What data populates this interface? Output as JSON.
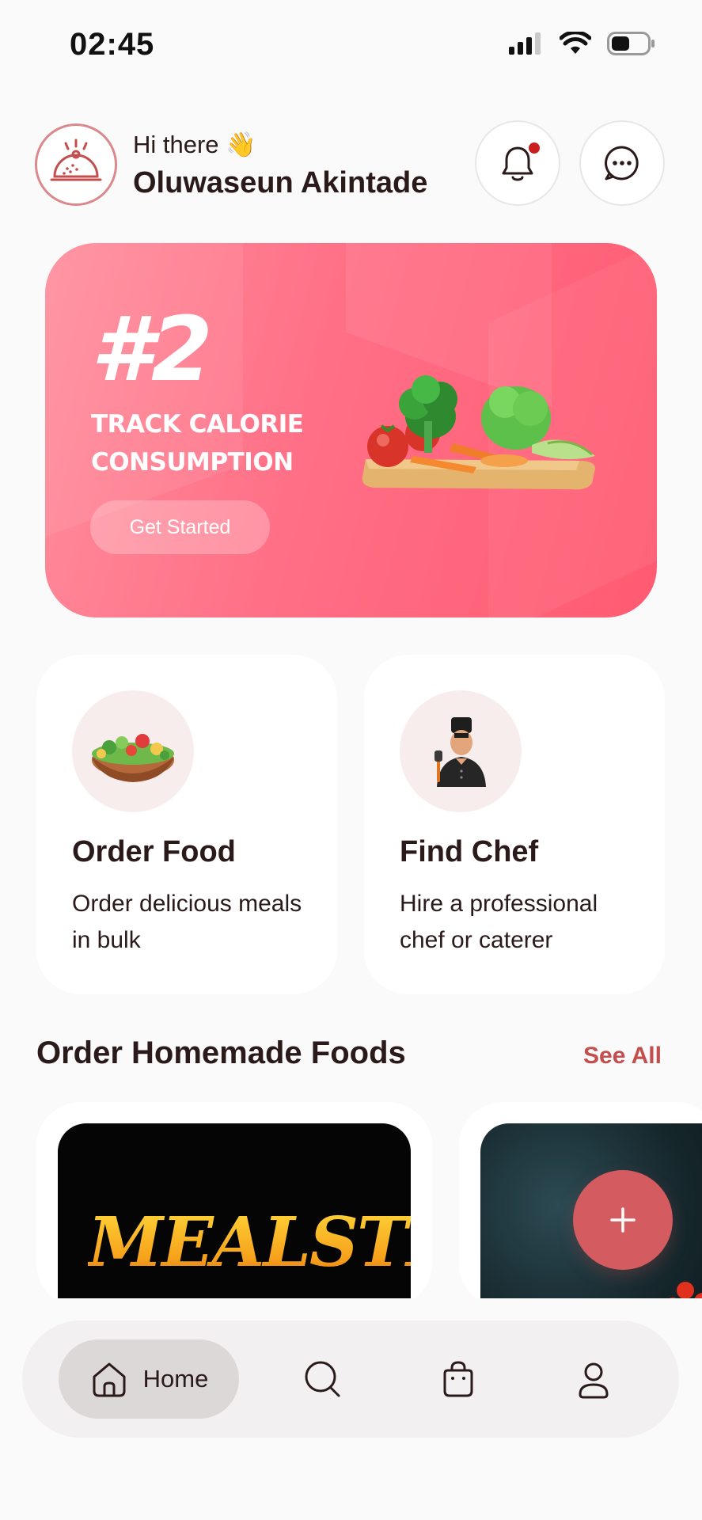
{
  "status_bar": {
    "time": "02:45"
  },
  "header": {
    "greeting": "Hi there 👋",
    "username": "Oluwaseun Akintade"
  },
  "banner": {
    "number": "#2",
    "title": "TRACK CALORIE CONSUMPTION",
    "button_label": "Get Started"
  },
  "services": [
    {
      "title": "Order Food",
      "description": "Order delicious meals in bulk",
      "icon": "salad-bowl-icon"
    },
    {
      "title": "Find Chef",
      "description": "Hire a professional chef or caterer",
      "icon": "chef-avatar-icon"
    }
  ],
  "homemade": {
    "section_title": "Order Homemade Foods",
    "see_all_label": "See All",
    "cards": [
      {
        "brand_text": "MEALSTICKK"
      },
      {
        "brand_text": ""
      }
    ]
  },
  "bottom_nav": {
    "items": [
      {
        "label": "Home",
        "icon": "home-icon",
        "active": true
      },
      {
        "label": "",
        "icon": "search-icon",
        "active": false
      },
      {
        "label": "",
        "icon": "bag-icon",
        "active": false
      },
      {
        "label": "",
        "icon": "profile-icon",
        "active": false
      }
    ]
  },
  "colors": {
    "accent": "#c24e4e",
    "banner_start": "#ff8e9c",
    "banner_end": "#ff5b72",
    "fab": "#d45b5f",
    "notification_dot": "#c81e1e"
  }
}
